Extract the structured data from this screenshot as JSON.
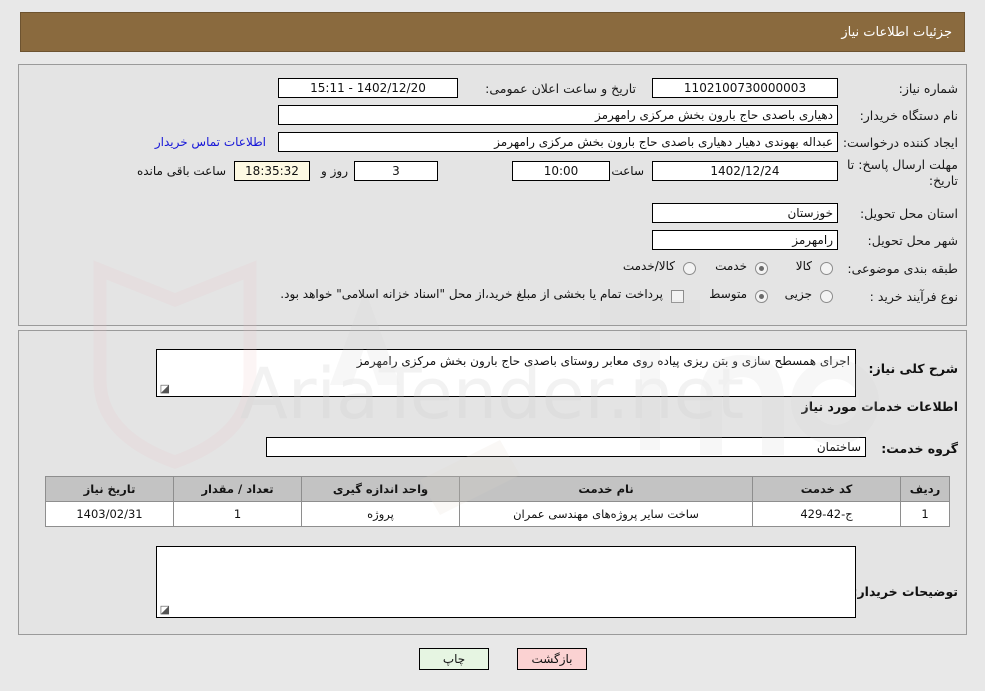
{
  "header": {
    "title": "جزئیات اطلاعات نیاز",
    "bar_color": "#8a6a3e"
  },
  "top_panel": {
    "need_number": {
      "label": "شماره نیاز:",
      "value": "1102100730000003"
    },
    "announce": {
      "label": "تاریخ و ساعت اعلان عمومی:",
      "value": "1402/12/20 - 15:11"
    },
    "buyer_org": {
      "label": "نام دستگاه خریدار:",
      "value": "دهیاری باصدی حاج بارون بخش مرکزی رامهرمز"
    },
    "request_creator": {
      "label": "ایجاد کننده درخواست:",
      "value": "عبداله بهوندی دهیار دهیاری باصدی حاج بارون بخش مرکزی رامهرمز"
    },
    "contact_link": {
      "label": "اطلاعات تماس خریدار"
    },
    "deadline": {
      "label": "مهلت ارسال پاسخ: تا تاریخ:",
      "date": "1402/12/24",
      "hour_label": "ساعت",
      "hour_value": "10:00",
      "days_value": "3",
      "days_label": "روز و",
      "countdown_value": "18:35:32",
      "countdown_label": "ساعت باقی مانده"
    },
    "province": {
      "label": "استان محل تحویل:",
      "value": "خوزستان"
    },
    "city": {
      "label": "شهر محل تحویل:",
      "value": "رامهرمز"
    },
    "category": {
      "label": "طبقه بندی موضوعی:",
      "options": [
        "کالا",
        "خدمت",
        "کالا/خدمت"
      ],
      "selected": "خدمت"
    },
    "purchase_type": {
      "label": "نوع فرآیند خرید :",
      "options": [
        "جزیی",
        "متوسط"
      ],
      "selected": "متوسط",
      "checkbox_label": "پرداخت تمام یا بخشی از مبلغ خرید،از محل \"اسناد خزانه اسلامی\" خواهد بود.",
      "checkbox_checked": false
    }
  },
  "bottom_panel": {
    "need_summary": {
      "label": "شرح کلی نیاز:",
      "value": "اجرای  همسطح سازی و بتن ریزی پیاده روی  معابر روستای باصدی حاج بارون بخش مرکزی رامهرمز"
    },
    "services_section_title": "اطلاعات خدمات مورد نیاز",
    "service_group": {
      "label": "گروه خدمت:",
      "value": "ساختمان"
    },
    "table": {
      "columns": [
        "ردیف",
        "کد خدمت",
        "نام خدمت",
        "واحد اندازه گیری",
        "تعداد / مقدار",
        "تاریخ نیاز"
      ],
      "rows": [
        {
          "row": "1",
          "code": "ج-42-429",
          "name": "ساخت سایر پروژه‌های مهندسی عمران",
          "unit": "پروژه",
          "quantity": "1",
          "date": "1403/02/31"
        }
      ]
    },
    "buyer_notes": {
      "label": "توضیحات خریدار:",
      "value": ""
    }
  },
  "footer": {
    "print_label": "چاپ",
    "back_label": "بازگشت"
  },
  "watermark": {
    "text": "AriaTender.net"
  }
}
